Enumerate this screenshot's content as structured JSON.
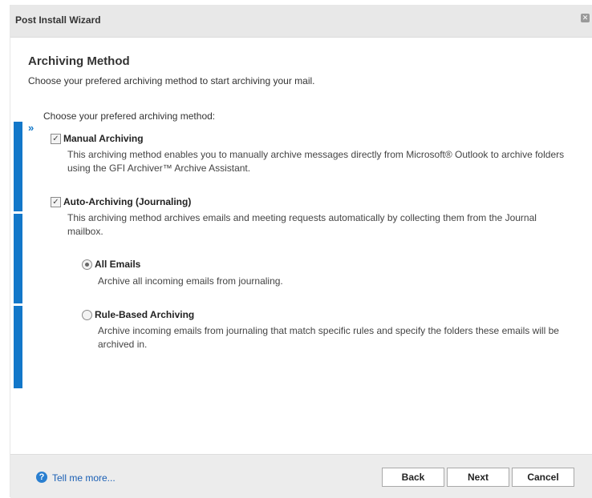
{
  "window": {
    "title": "Post Install Wizard"
  },
  "page": {
    "heading": "Archiving Method",
    "subheading": "Choose your prefered archiving method to start archiving your mail.",
    "choose_label": "Choose your prefered archiving method:"
  },
  "options": {
    "manual": {
      "label": "Manual Archiving",
      "checked": true,
      "desc_line1": "This archiving method enables you to manually archive messages directly from Microsoft® Outlook to archive folders",
      "desc_line2": "using the GFI Archiver™ Archive Assistant."
    },
    "auto": {
      "label": "Auto-Archiving (Journaling)",
      "checked": true,
      "desc_line1": "This archiving method archives emails and meeting requests automatically by collecting them from the Journal",
      "desc_line2": "mailbox."
    },
    "all_emails": {
      "label": "All Emails",
      "selected": true,
      "desc": "Archive all incoming emails from journaling."
    },
    "rule_based": {
      "label": "Rule-Based Archiving",
      "selected": false,
      "desc_line1": "Archive incoming emails from journaling that match specific rules and specify the folders these emails will be",
      "desc_line2": "archived in."
    }
  },
  "footer": {
    "help_link": "Tell me more...",
    "back_label": "Back",
    "next_label": "Next",
    "cancel_label": "Cancel"
  },
  "colors": {
    "accent": "#1277c9",
    "link": "#1a5fb4"
  }
}
